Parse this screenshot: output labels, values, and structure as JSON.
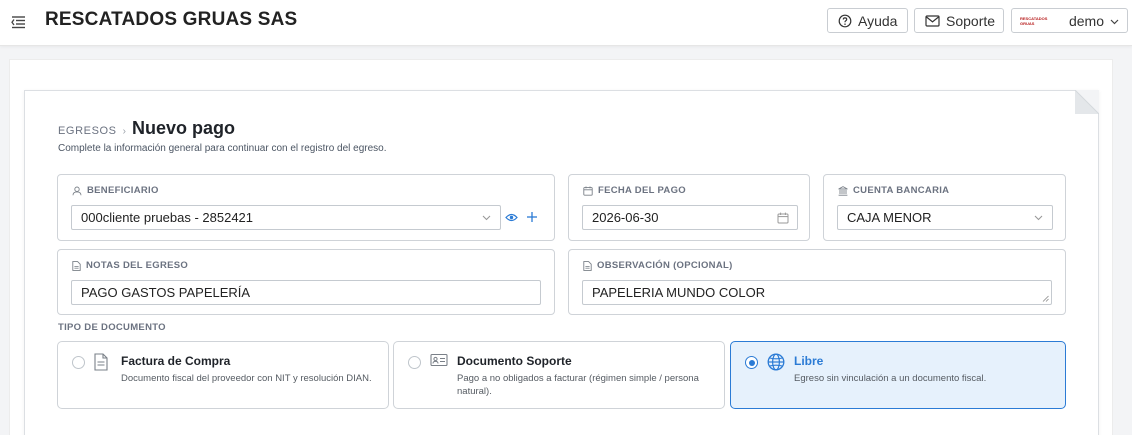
{
  "app": {
    "company": "RESCATADOS GRUAS SAS"
  },
  "header": {
    "help_label": "Ayuda",
    "support_label": "Soporte",
    "user_name": "demo",
    "user_logo_text": "RESCATADOS GRUAS"
  },
  "page": {
    "breadcrumb_parent": "EGRESOS",
    "breadcrumb_separator": "›",
    "title": "Nuevo pago",
    "subtitle": "Complete la información general para continuar con el registro del egreso."
  },
  "form": {
    "beneficiario": {
      "label": "BENEFICIARIO",
      "value": "000cliente pruebas - 2852421",
      "icon": "user-icon"
    },
    "fecha": {
      "label": "FECHA DEL PAGO",
      "value": "2026-06-30",
      "icon": "calendar-icon"
    },
    "cuenta": {
      "label": "CUENTA BANCARIA",
      "value": "CAJA MENOR",
      "icon": "bank-icon"
    },
    "notas": {
      "label": "NOTAS DEL EGRESO",
      "value": "PAGO GASTOS PAPELERÍA",
      "icon": "file-icon"
    },
    "observacion": {
      "label": "OBSERVACIÓN (OPCIONAL)",
      "value": "PAPELERIA MUNDO COLOR",
      "icon": "file-icon"
    }
  },
  "document_type": {
    "label": "TIPO DE DOCUMENTO",
    "options": [
      {
        "title": "Factura de Compra",
        "description": "Documento fiscal del proveedor con NIT y resolución DIAN.",
        "icon": "document-icon",
        "selected": false
      },
      {
        "title": "Documento Soporte",
        "description": "Pago a no obligados a facturar (régimen simple / persona natural).",
        "icon": "id-card-icon",
        "selected": false
      },
      {
        "title": "Libre",
        "description": "Egreso sin vinculación a un documento fiscal.",
        "icon": "globe-icon",
        "selected": true
      }
    ]
  },
  "colors": {
    "accent": "#2b7bd5",
    "selected_bg": "#e6f1fc",
    "brand_logo": "#b71c1c"
  }
}
